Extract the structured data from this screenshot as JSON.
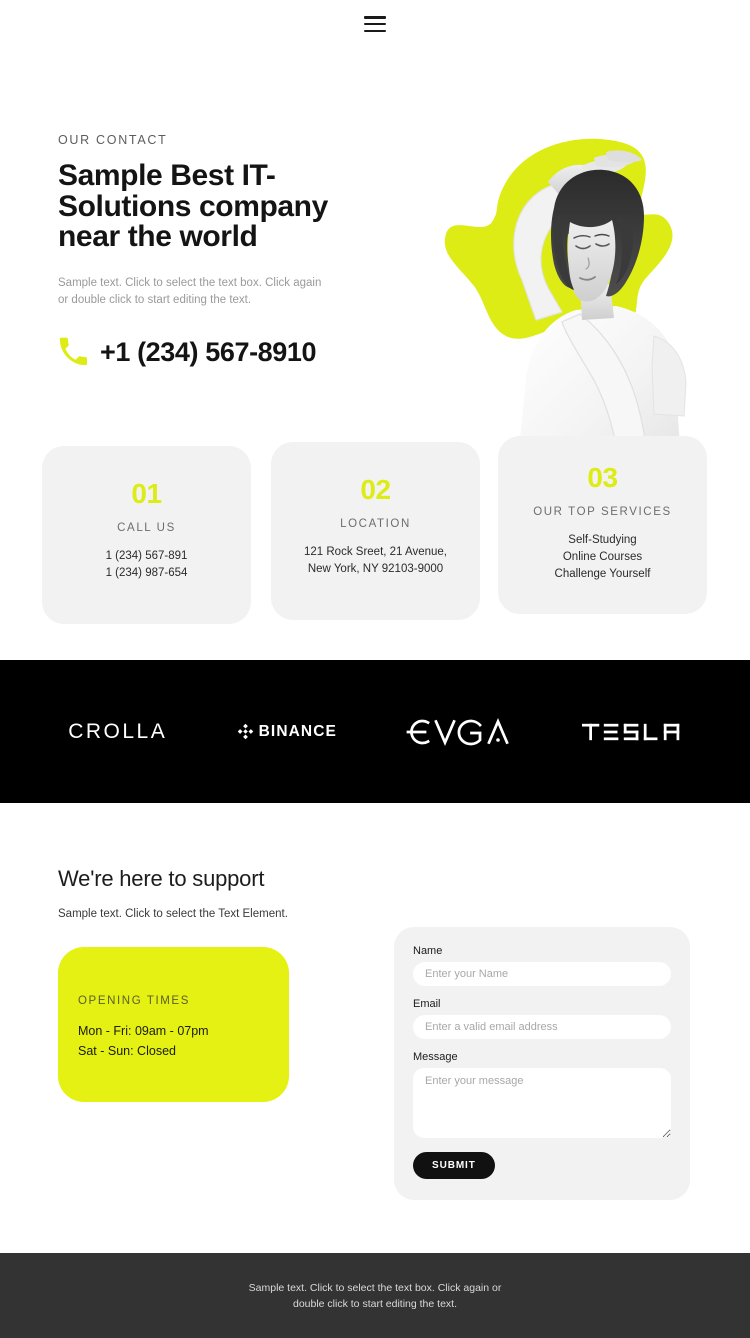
{
  "header": {
    "menu_icon": "hamburger-menu-icon"
  },
  "hero": {
    "eyebrow": "OUR CONTACT",
    "title": "Sample Best IT-Solutions company near the world",
    "subtitle": "Sample text. Click to select the text box. Click again or double click to start editing the text.",
    "phone_icon": "phone-icon",
    "phone": "+1 (234) 567-8910"
  },
  "cards": [
    {
      "number": "01",
      "label": "CALL US",
      "lines": [
        "1 (234) 567-891",
        "1 (234) 987-654"
      ]
    },
    {
      "number": "02",
      "label": "LOCATION",
      "lines": [
        "121 Rock Sreet, 21 Avenue,",
        "New York, NY 92103-9000"
      ]
    },
    {
      "number": "03",
      "label": "OUR TOP SERVICES",
      "lines": [
        "Self-Studying",
        "Online Courses",
        "Challenge Yourself"
      ]
    }
  ],
  "logos": [
    {
      "name": "crolla-logo",
      "text": "CROLLA"
    },
    {
      "name": "binance-logo",
      "text": "BINANCE"
    },
    {
      "name": "evga-logo",
      "text": "EVGA"
    },
    {
      "name": "tesla-logo",
      "text": "TESLA"
    }
  ],
  "support": {
    "title": "We're here to support",
    "subtitle": "Sample text. Click to select the Text Element.",
    "hours_label": "OPENING TIMES",
    "hours_lines": [
      "Mon - Fri: 09am - 07pm",
      "Sat - Sun: Closed"
    ]
  },
  "form": {
    "name_label": "Name",
    "name_placeholder": "Enter your Name",
    "name_value": "",
    "email_label": "Email",
    "email_placeholder": "Enter a valid email address",
    "email_value": "",
    "message_label": "Message",
    "message_placeholder": "Enter your message",
    "message_value": "",
    "submit_label": "SUBMIT"
  },
  "footer": {
    "text": "Sample text. Click to select the text box. Click again or double click to start editing the text."
  },
  "colors": {
    "accent_yellow": "#dcec14",
    "hours_yellow": "#e4f112",
    "band_black": "#000000",
    "footer_gray": "#333333",
    "card_gray": "#f2f2f2"
  }
}
